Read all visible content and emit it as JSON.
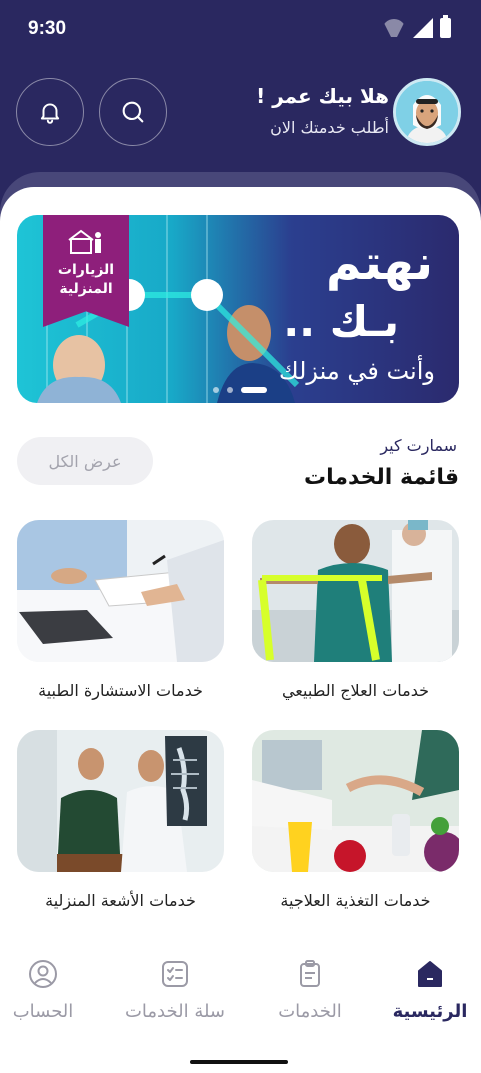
{
  "status_bar": {
    "time": "9:30"
  },
  "header": {
    "greeting": "هلا بيك عمر !",
    "subtitle": "أطلب خدمتك الان"
  },
  "banner": {
    "ribbon_text": "الزيارات المنزلية",
    "headline_1": "نهتم",
    "headline_2": "بـك ..",
    "headline_3": "وأنت في منزلك"
  },
  "section": {
    "subtitle": "سمارت كير",
    "title": "قائمة الخدمات",
    "view_all": "عرض الكل"
  },
  "services": [
    {
      "label": "خدمات العلاج الطبيعي",
      "icon": "physiotherapy-photo"
    },
    {
      "label": "خدمات الاستشارة الطبية",
      "icon": "consultation-photo"
    },
    {
      "label": "خدمات التغذية العلاجية",
      "icon": "nutrition-photo"
    },
    {
      "label": "خدمات الأشعة المنزلية",
      "icon": "xray-photo"
    }
  ],
  "tabs": [
    {
      "label": "الرئيسية",
      "icon": "home-icon",
      "active": true
    },
    {
      "label": "الخدمات",
      "icon": "clipboard-icon",
      "active": false
    },
    {
      "label": "سلة الخدمات",
      "icon": "checklist-icon",
      "active": false
    },
    {
      "label": "الحساب",
      "icon": "user-icon",
      "active": false
    }
  ],
  "colors": {
    "primary": "#2a2860",
    "accent": "#8e1f7b",
    "teal": "#1ec4d6"
  }
}
